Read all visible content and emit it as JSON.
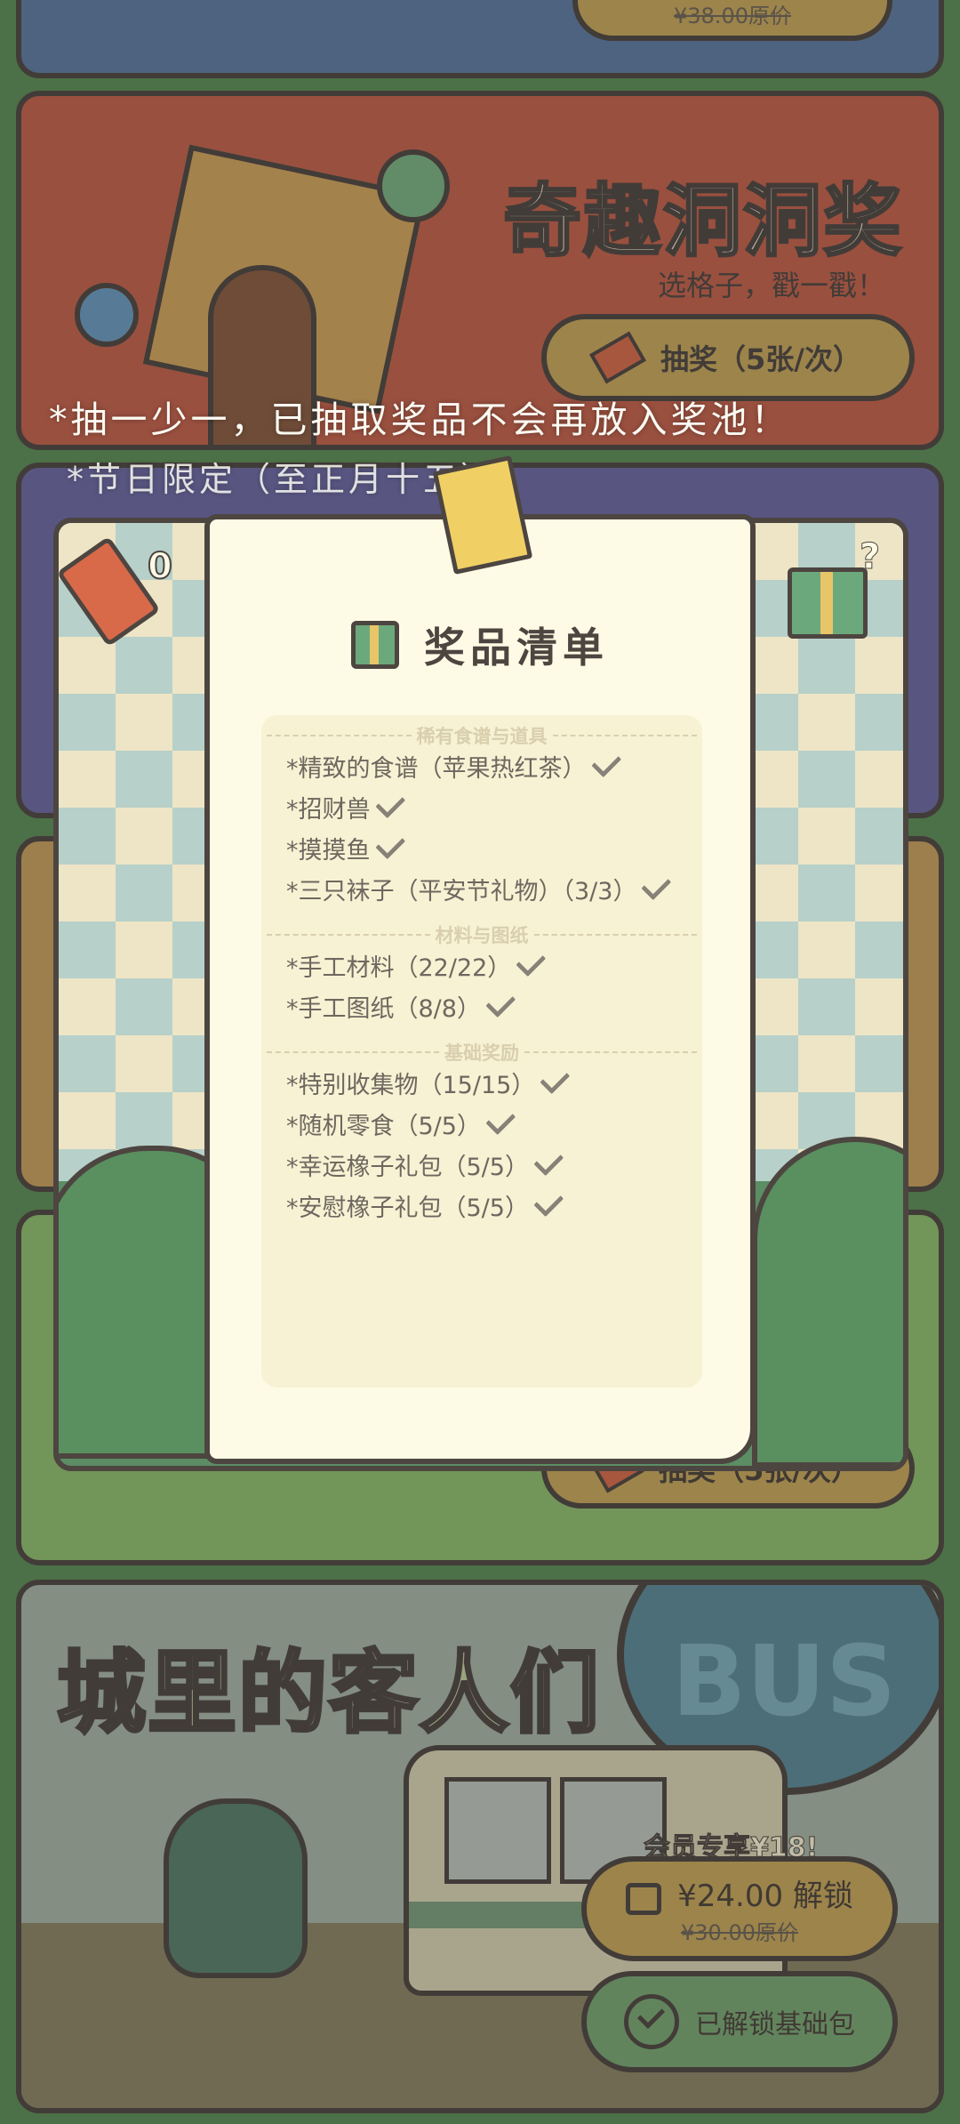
{
  "colors": {
    "dark": "#4d4540",
    "red": "#c6604a",
    "blue": "#5d7aa3",
    "gold": "#c9a85a",
    "green": "#5a8d55"
  },
  "top_card": {
    "original_price": "¥38.00原价"
  },
  "hole_lottery": {
    "title": "奇趣洞洞奖",
    "subtitle": "选格子，戳一戳！",
    "draw_button": "抽奖（5张/次）"
  },
  "notices": {
    "line1": "*抽一少一，已抽取奖品不会再放入奖池！",
    "line2": "*节日限定（至正月十五）"
  },
  "ticket_count": "0",
  "draw_button_2": "抽奖（5张/次）",
  "prize_list": {
    "title": "奖品清单",
    "sections": [
      {
        "label": "稀有食谱与道具",
        "items": [
          "*精致的食谱（苹果热红茶）",
          "*招财兽",
          "*摸摸鱼",
          "*三只袜子（平安节礼物）（3/3）"
        ]
      },
      {
        "label": "材料与图纸",
        "items": [
          "*手工材料（22/22）",
          "*手工图纸（8/8）"
        ]
      },
      {
        "label": "基础奖励",
        "items": [
          "*特别收集物（15/15）",
          "*随机零食（5/5）",
          "*幸运橡子礼包（5/5）",
          "*安慰橡子礼包（5/5）"
        ]
      }
    ]
  },
  "city_guests": {
    "title": "城里的客人们",
    "bus_sign": "BUS",
    "member_badge": "会员专享¥18!",
    "unlock_button": "¥24.00 解锁",
    "original_price": "¥30.00原价",
    "unlocked_button": "已解锁基础包"
  },
  "icons": [
    "lock-icon",
    "ticket-icon",
    "gift-icon",
    "mystery-gift-icon",
    "check-icon"
  ]
}
